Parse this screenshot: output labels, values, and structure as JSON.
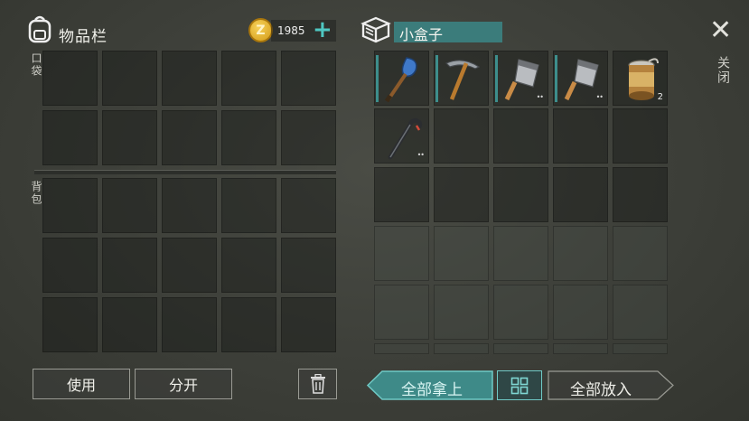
{
  "inventory": {
    "title": "物品栏",
    "pocket_label": "口袋",
    "backpack_label": "背包"
  },
  "currency": {
    "amount": "1985",
    "coin_letter": "Z",
    "add_symbol": "+"
  },
  "container": {
    "name": "小盒子",
    "items": [
      {
        "slot": 0,
        "name": "paddle-icon",
        "tag": true
      },
      {
        "slot": 1,
        "name": "pickaxe-icon",
        "tag": true
      },
      {
        "slot": 2,
        "name": "cleaver-icon",
        "tag": true,
        "dots": "••"
      },
      {
        "slot": 3,
        "name": "cleaver-icon",
        "tag": true,
        "dots": "••"
      },
      {
        "slot": 4,
        "name": "can-icon",
        "qty": "2"
      },
      {
        "slot": 5,
        "name": "crowbar-icon",
        "dots": "••"
      }
    ]
  },
  "close": {
    "label": "关闭",
    "symbol": "✕"
  },
  "buttons": {
    "use": "使用",
    "split": "分开",
    "take_all": "全部拿上",
    "put_all": "全部放入"
  },
  "colors": {
    "accent_teal": "#3d8e8c",
    "coin_gold": "#e8b52a",
    "button_border": "#9a9b94"
  }
}
